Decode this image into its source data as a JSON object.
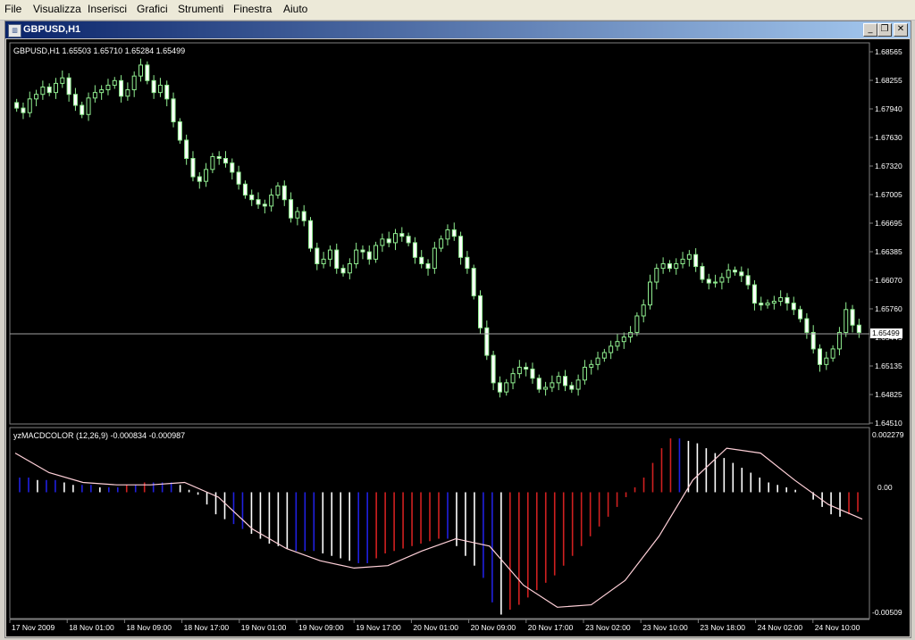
{
  "menu": [
    "File",
    "Visualizza",
    "Inserisci",
    "Grafici",
    "Strumenti",
    "Finestra",
    "Aiuto"
  ],
  "window": {
    "title": "GBPUSD,H1",
    "minimize_glyph": "_",
    "restore_glyph": "❐",
    "close_glyph": "✕"
  },
  "price_panel": {
    "header": "GBPUSD,H1  1.65503  1.65710  1.65284  1.65499",
    "current_price": "1.65499",
    "price_labels": [
      "1.68565",
      "1.68255",
      "1.67940",
      "1.67630",
      "1.67320",
      "1.67005",
      "1.66695",
      "1.66385",
      "1.66070",
      "1.65760",
      "1.65445",
      "1.65135",
      "1.64825",
      "1.64510"
    ],
    "candle_color": "#90ee90",
    "bid_line_color": "#a0a0a0"
  },
  "macd_panel": {
    "header": "yzMACDCOLOR (12,26,9) -0.000834 -0.000987",
    "labels": [
      "0.002279",
      "0.00",
      "-0.00509"
    ],
    "colors": {
      "white": "#ffffff",
      "blue": "#2020e0",
      "red": "#d02020",
      "signal": "#ffd0d8"
    }
  },
  "time_labels": [
    "17 Nov 2009",
    "18 Nov 01:00",
    "18 Nov 09:00",
    "18 Nov 17:00",
    "19 Nov 01:00",
    "19 Nov 09:00",
    "19 Nov 17:00",
    "20 Nov 01:00",
    "20 Nov 09:00",
    "20 Nov 17:00",
    "23 Nov 02:00",
    "23 Nov 10:00",
    "23 Nov 18:00",
    "24 Nov 02:00",
    "24 Nov 10:00"
  ],
  "chart_data": {
    "type": "line",
    "symbol": "GBPUSD",
    "timeframe": "H1",
    "ohlc_last": {
      "open": 1.65503,
      "high": 1.6571,
      "low": 1.65284,
      "close": 1.65499
    },
    "close_series": [
      1.6795,
      1.679,
      1.6805,
      1.681,
      1.6818,
      1.6812,
      1.6822,
      1.6828,
      1.681,
      1.6798,
      1.6788,
      1.6806,
      1.6812,
      1.6815,
      1.682,
      1.6825,
      1.6808,
      1.6815,
      1.683,
      1.6842,
      1.6825,
      1.6812,
      1.682,
      1.6805,
      1.678,
      1.676,
      1.674,
      1.672,
      1.6715,
      1.6728,
      1.6742,
      1.674,
      1.6735,
      1.6725,
      1.6712,
      1.67,
      1.6695,
      1.669,
      1.6688,
      1.67,
      1.671,
      1.6695,
      1.6675,
      1.6682,
      1.6672,
      1.6642,
      1.6625,
      1.663,
      1.664,
      1.662,
      1.6615,
      1.6625,
      1.664,
      1.6638,
      1.663,
      1.6645,
      1.6652,
      1.6648,
      1.6658,
      1.6655,
      1.6648,
      1.6632,
      1.6625,
      1.662,
      1.6642,
      1.6652,
      1.6662,
      1.6655,
      1.6632,
      1.662,
      1.659,
      1.6555,
      1.6525,
      1.6495,
      1.6485,
      1.6495,
      1.6505,
      1.6512,
      1.651,
      1.65,
      1.6488,
      1.649,
      1.6495,
      1.6502,
      1.6492,
      1.6488,
      1.6498,
      1.6512,
      1.6515,
      1.6522,
      1.6528,
      1.6535,
      1.654,
      1.6545,
      1.655,
      1.6568,
      1.658,
      1.6605,
      1.662,
      1.6625,
      1.662,
      1.6625,
      1.663,
      1.6635,
      1.6622,
      1.6608,
      1.6604,
      1.6605,
      1.661,
      1.6618,
      1.6616,
      1.6612,
      1.6602,
      1.6582,
      1.658,
      1.6582,
      1.6584,
      1.6588,
      1.6582,
      1.6575,
      1.6565,
      1.655,
      1.6532,
      1.6515,
      1.6522,
      1.6532,
      1.655,
      1.6575,
      1.6558,
      1.655
    ],
    "macd_histogram": [
      0.0006,
      0.0006,
      0.0005,
      0.0005,
      0.0005,
      0.0004,
      0.0003,
      0.0003,
      0.0003,
      0.0002,
      0.0002,
      0.0002,
      0.0003,
      0.0003,
      0.0004,
      0.0004,
      0.0004,
      0.0004,
      0.0003,
      0.0001,
      -0.0001,
      -0.0005,
      -0.0009,
      -0.0011,
      -0.0013,
      -0.0015,
      -0.0017,
      -0.0019,
      -0.0021,
      -0.0022,
      -0.0023,
      -0.0024,
      -0.0024,
      -0.0024,
      -0.0025,
      -0.0026,
      -0.0027,
      -0.0028,
      -0.0029,
      -0.0029,
      -0.0027,
      -0.0025,
      -0.0024,
      -0.0023,
      -0.0022,
      -0.0021,
      -0.002,
      -0.0019,
      -0.0019,
      -0.0022,
      -0.0026,
      -0.003,
      -0.0035,
      -0.0045,
      -0.005,
      -0.0048,
      -0.0046,
      -0.0043,
      -0.004,
      -0.0037,
      -0.0034,
      -0.003,
      -0.0026,
      -0.0022,
      -0.0018,
      -0.0014,
      -0.001,
      -0.0006,
      -0.0002,
      0.0002,
      0.0006,
      0.0012,
      0.0018,
      0.0022,
      0.0022,
      0.0021,
      0.002,
      0.0018,
      0.0016,
      0.0014,
      0.0012,
      0.001,
      0.0008,
      0.0006,
      0.0004,
      0.0003,
      0.0002,
      0.0001,
      0,
      -0.0003,
      -0.0006,
      -0.0009,
      -0.001,
      -0.0009,
      -0.0008
    ],
    "signal_line": [
      0.0016,
      0.0008,
      0.0004,
      0.0003,
      0.0003,
      0.0004,
      -0.0002,
      -0.0015,
      -0.0023,
      -0.0028,
      -0.0031,
      -0.003,
      -0.0024,
      -0.0019,
      -0.0022,
      -0.0038,
      -0.0047,
      -0.0046,
      -0.0036,
      -0.0018,
      0.0005,
      0.0018,
      0.0016,
      0.0005,
      -0.0005,
      -0.0011
    ],
    "price_ylim": [
      1.6451,
      1.68565
    ],
    "macd_ylim": [
      -0.00509,
      0.002279
    ]
  }
}
